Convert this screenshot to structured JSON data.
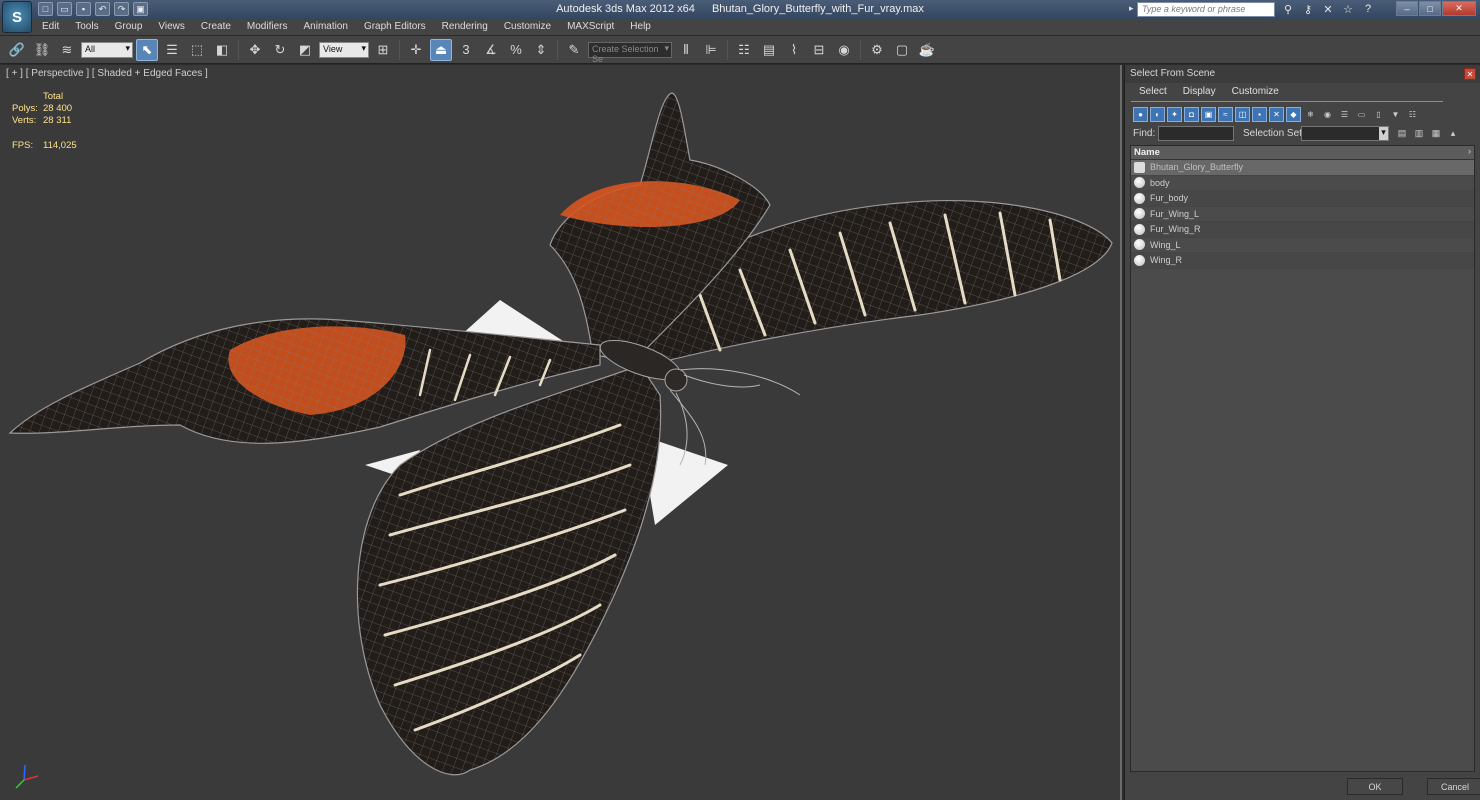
{
  "window": {
    "app_title": "Autodesk 3ds Max  2012 x64",
    "file_name": "Bhutan_Glory_Butterfly_with_Fur_vray.max",
    "search_placeholder": "Type a keyword or phrase",
    "logo_letter": "S"
  },
  "menu": [
    "Edit",
    "Tools",
    "Group",
    "Views",
    "Create",
    "Modifiers",
    "Animation",
    "Graph Editors",
    "Rendering",
    "Customize",
    "MAXScript",
    "Help"
  ],
  "toolbar": {
    "filter_dropdown": "All",
    "view_dropdown": "View",
    "selection_set_dropdown": "Create Selection Se",
    "snap_3_label": "3",
    "percent_label": "%"
  },
  "viewport": {
    "label": "[ + ] [ Perspective ] [ Shaded + Edged Faces ]",
    "stats_header": "Total",
    "stats": [
      {
        "key": "Polys:",
        "value": "28 400"
      },
      {
        "key": "Verts:",
        "value": "28 311"
      }
    ],
    "fps_key": "FPS:",
    "fps_value": "114,025",
    "colors": {
      "background": "#3a3a3a",
      "stats": "#ffe38c",
      "wing_dark": "#1e1a17",
      "wing_orange": "#d8551f",
      "stripe": "#e8e0cc",
      "wire": "#8c8c8c"
    }
  },
  "panel": {
    "title": "Select From Scene",
    "menu": [
      "Select",
      "Display",
      "Customize"
    ],
    "find_label": "Find:",
    "selection_set_label": "Selection Set:",
    "list_header": "Name",
    "objects": [
      {
        "name": "Bhutan_Glory_Butterfly",
        "icon": "group-icon"
      },
      {
        "name": "body",
        "icon": "sphere-icon"
      },
      {
        "name": "Fur_body",
        "icon": "sphere-icon"
      },
      {
        "name": "Fur_Wing_L",
        "icon": "sphere-icon"
      },
      {
        "name": "Fur_Wing_R",
        "icon": "sphere-icon"
      },
      {
        "name": "Wing_L",
        "icon": "sphere-icon"
      },
      {
        "name": "Wing_R",
        "icon": "sphere-icon"
      }
    ],
    "ok_label": "OK",
    "cancel_label": "Cancel"
  }
}
